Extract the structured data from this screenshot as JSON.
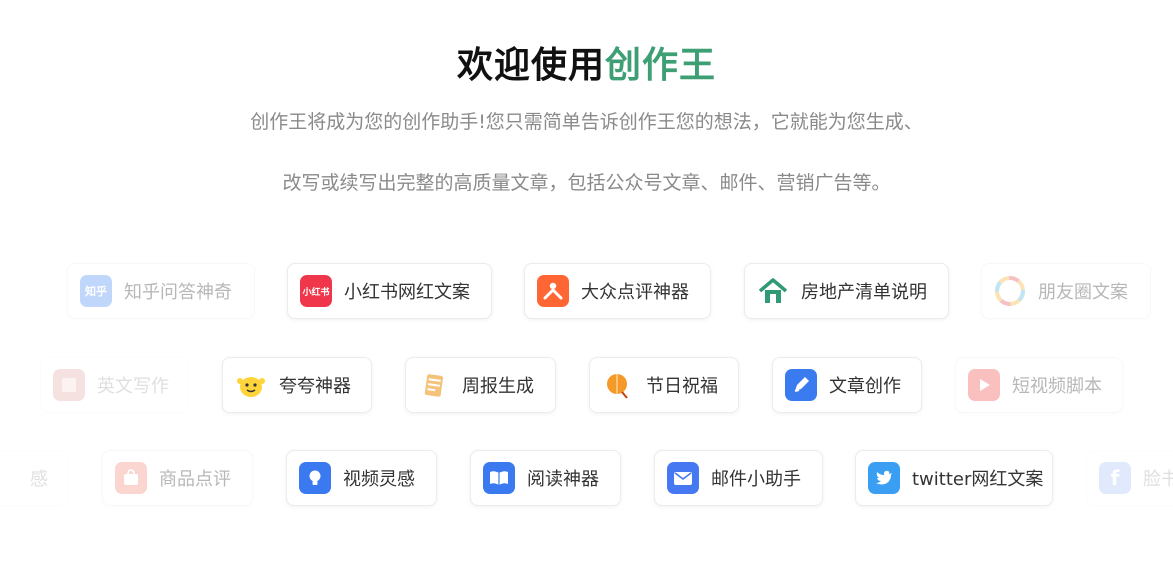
{
  "header": {
    "title_prefix": "欢迎使用",
    "title_accent": "创作王",
    "subtitle_line1": "创作王将成为您的创作助手!您只需简单告诉创作王您的想法，它就能为您生成、",
    "subtitle_line2": "改写或续写出完整的高质量文章，包括公众号文章、邮件、营销广告等。"
  },
  "rows": {
    "row1": [
      {
        "label": "知乎问答神奇",
        "icon": "zhihu-icon",
        "icon_text": "知乎"
      },
      {
        "label": "小红书网红文案",
        "icon": "xiaohongshu-icon",
        "icon_text": "小红书"
      },
      {
        "label": "大众点评神器",
        "icon": "dianping-icon"
      },
      {
        "label": "房地产清单说明",
        "icon": "house-icon"
      },
      {
        "label": "朋友圈文案",
        "icon": "moments-icon"
      }
    ],
    "row2": [
      {
        "label": "英文写作",
        "icon": "book-icon"
      },
      {
        "label": "夸夸神器",
        "icon": "cheer-icon"
      },
      {
        "label": "周报生成",
        "icon": "notepad-icon"
      },
      {
        "label": "节日祝福",
        "icon": "lantern-icon"
      },
      {
        "label": "文章创作",
        "icon": "pen-icon"
      },
      {
        "label": "短视频脚本",
        "icon": "play-icon"
      }
    ],
    "row3": [
      {
        "label": "感",
        "icon": ""
      },
      {
        "label": "商品点评",
        "icon": "shopping-bag-icon"
      },
      {
        "label": "视频灵感",
        "icon": "lightbulb-icon"
      },
      {
        "label": "阅读神器",
        "icon": "open-book-icon"
      },
      {
        "label": "邮件小助手",
        "icon": "mail-icon"
      },
      {
        "label": "twitter网红文案",
        "icon": "twitter-icon"
      },
      {
        "label": "脸书",
        "icon": "facebook-icon",
        "icon_text": "f"
      }
    ]
  }
}
